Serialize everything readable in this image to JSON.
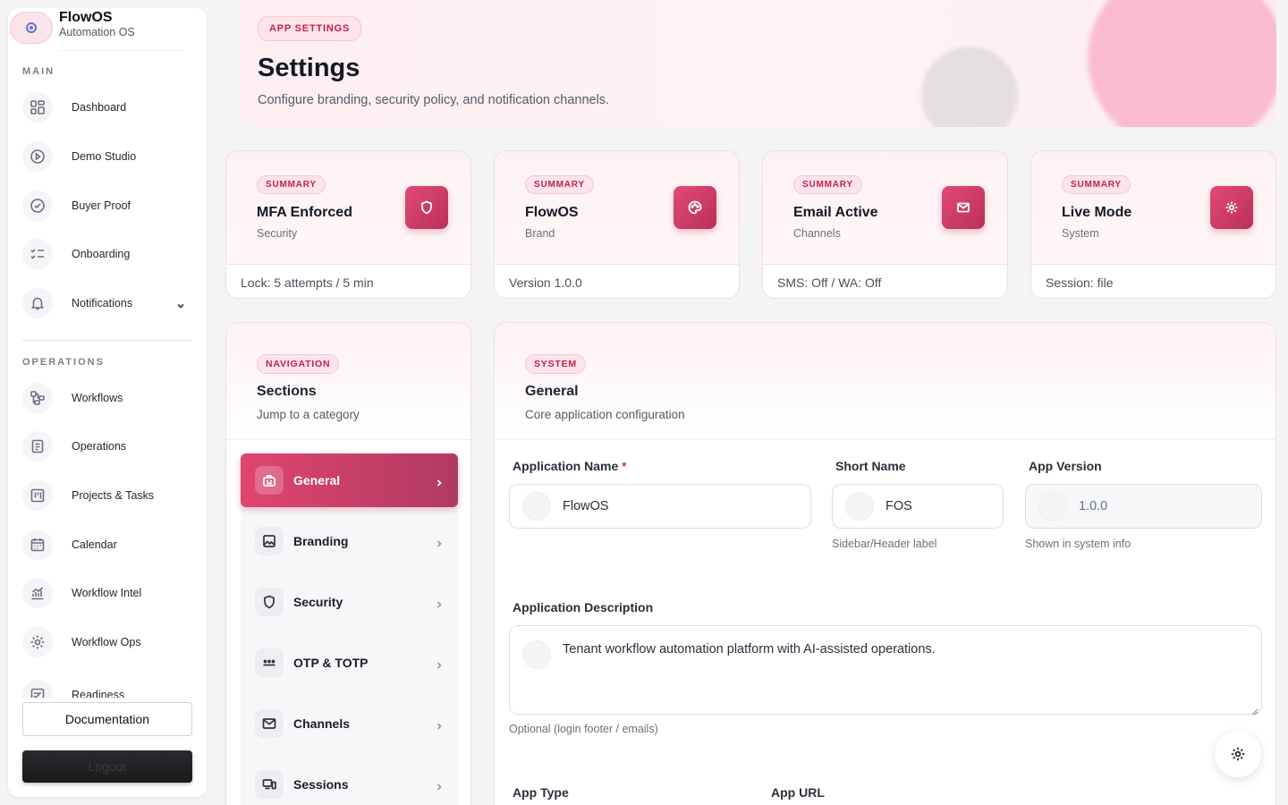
{
  "sidebar": {
    "brand_name": "FlowOS",
    "brand_sub": "Automation OS",
    "main_label": "MAIN",
    "operations_label": "OPERATIONS",
    "main_items": [
      {
        "label": "Dashboard",
        "icon": "dashboard-icon"
      },
      {
        "label": "Demo Studio",
        "icon": "play-circle-icon"
      },
      {
        "label": "Buyer Proof",
        "icon": "check-circle-icon"
      },
      {
        "label": "Onboarding",
        "icon": "checklist-icon"
      },
      {
        "label": "Notifications",
        "icon": "bell-icon"
      }
    ],
    "operations_items": [
      {
        "label": "Workflows",
        "icon": "workflow-icon"
      },
      {
        "label": "Operations",
        "icon": "clipboard-icon"
      },
      {
        "label": "Projects & Tasks",
        "icon": "kanban-icon"
      },
      {
        "label": "Calendar",
        "icon": "calendar-icon"
      },
      {
        "label": "Workflow Intel",
        "icon": "chart-icon"
      },
      {
        "label": "Workflow Ops",
        "icon": "gear-icon"
      },
      {
        "label": "Readiness",
        "icon": "readiness-icon"
      }
    ],
    "documentation_label": "Documentation",
    "logout_label": "Logout"
  },
  "header": {
    "pill": "APP SETTINGS",
    "title": "Settings",
    "description": "Configure branding, security policy, and notification channels."
  },
  "summary_cards": [
    {
      "pill": "SUMMARY",
      "title": "MFA Enforced",
      "sub": "Security",
      "footer": "Lock: 5 attempts / 5 min",
      "icon": "shield-icon"
    },
    {
      "pill": "SUMMARY",
      "title": "FlowOS",
      "sub": "Brand",
      "footer": "Version 1.0.0",
      "icon": "palette-icon"
    },
    {
      "pill": "SUMMARY",
      "title": "Email Active",
      "sub": "Channels",
      "footer": "SMS: Off / WA: Off",
      "icon": "mail-icon"
    },
    {
      "pill": "SUMMARY",
      "title": "Live Mode",
      "sub": "System",
      "footer": "Session: file",
      "icon": "gear-icon"
    }
  ],
  "sections": {
    "pill": "NAVIGATION",
    "title": "Sections",
    "sub": "Jump to a category",
    "items": [
      {
        "label": "General",
        "icon": "general-icon",
        "active": true
      },
      {
        "label": "Branding",
        "icon": "image-icon",
        "active": false
      },
      {
        "label": "Security",
        "icon": "shield-icon",
        "active": false
      },
      {
        "label": "OTP & TOTP",
        "icon": "dots-icon",
        "active": false
      },
      {
        "label": "Channels",
        "icon": "mail-icon",
        "active": false
      },
      {
        "label": "Sessions",
        "icon": "devices-icon",
        "active": false
      }
    ]
  },
  "general": {
    "pill": "SYSTEM",
    "title": "General",
    "sub": "Core application configuration",
    "app_name_label": "Application Name",
    "required_mark": "*",
    "app_name_value": "FlowOS",
    "short_name_label": "Short Name",
    "short_name_value": "FOS",
    "short_name_help": "Sidebar/Header label",
    "app_version_label": "App Version",
    "app_version_value": "1.0.0",
    "app_version_help": "Shown in system info",
    "description_label": "Application Description",
    "description_value": "Tenant workflow automation platform with AI-assisted operations.",
    "description_help": "Optional (login footer / emails)",
    "app_type_label": "App Type",
    "app_url_label": "App URL"
  },
  "colors": {
    "accent": "#d9426f",
    "accent_dark": "#b03a62",
    "pill_text": "#c0204f",
    "pill_bg": "#fde3ea"
  }
}
